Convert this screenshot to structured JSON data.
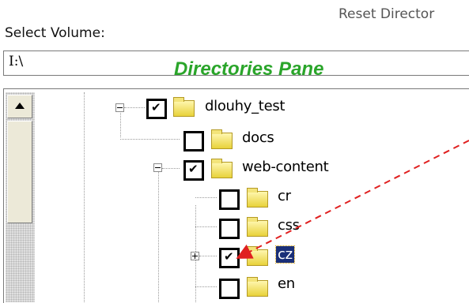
{
  "toolbar": {
    "reset_label": "Reset Director"
  },
  "volume": {
    "label": "Select Volume:",
    "value": "I:\\"
  },
  "annotation": {
    "pane_title": "Directories Pane",
    "arrow_color": "#e02020",
    "title_color": "#2aa52a"
  },
  "tree": {
    "nodes": [
      {
        "name": "dlouhy_test",
        "checked": "✔"
      },
      {
        "name": "docs",
        "checked": ""
      },
      {
        "name": "web-content",
        "checked": "✔"
      },
      {
        "name": "cr",
        "checked": ""
      },
      {
        "name": "css",
        "checked": ""
      },
      {
        "name": "cz",
        "checked": "✔",
        "selected": true
      },
      {
        "name": "en",
        "checked": ""
      }
    ]
  },
  "icons": {
    "scroll_up": "scroll-up-arrow-icon",
    "expand": "plus-box-icon",
    "collapse": "minus-box-icon",
    "folder": "folder-icon"
  }
}
